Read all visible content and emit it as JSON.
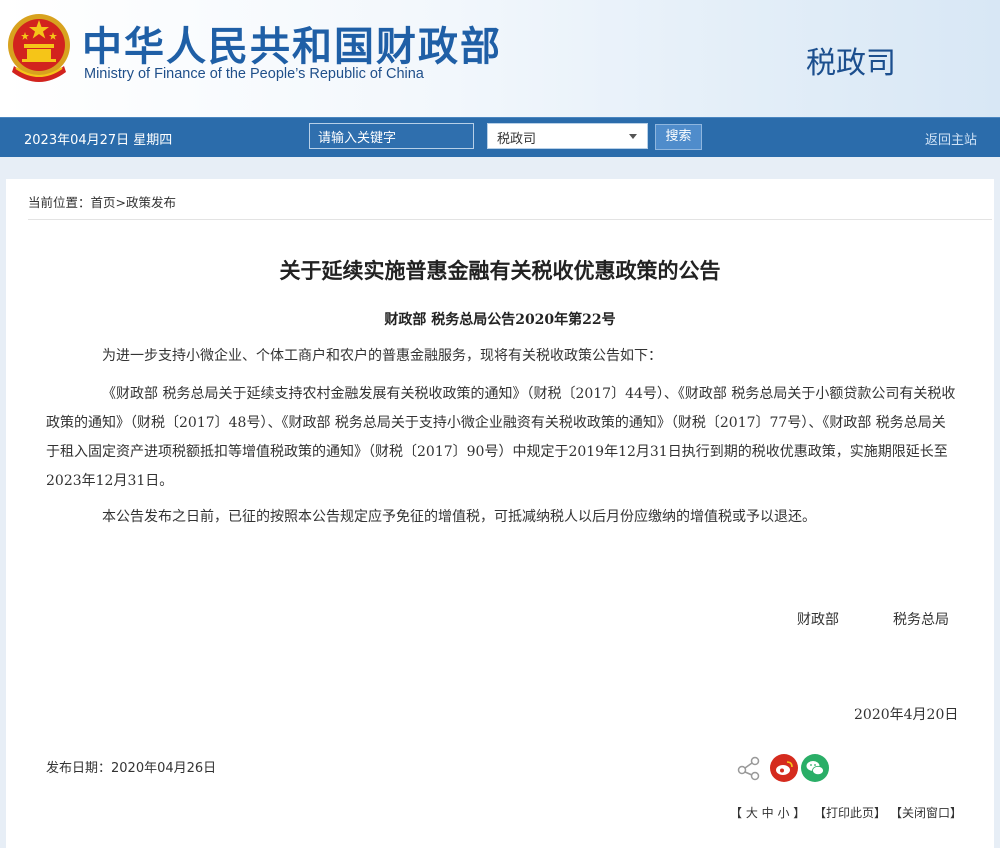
{
  "header": {
    "site_name_cn": "中华人民共和国财政部",
    "site_name_en": "Ministry of Finance of the People’s Republic of China",
    "department": "税政司"
  },
  "topbar": {
    "date": "2023年04月27日  星期四",
    "search_placeholder": "请输入关键字",
    "select_value": "税政司",
    "search_button": "搜索",
    "home_link": "返回主站"
  },
  "breadcrumb": "当前位置：首页>政策发布",
  "article": {
    "title": "关于延续实施普惠金融有关税收优惠政策的公告",
    "doc_number": "财政部  税务总局公告2020年第22号",
    "paragraphs": [
      "为进一步支持小微企业、个体工商户和农户的普惠金融服务，现将有关税收政策公告如下：",
      "《财政部  税务总局关于延续支持农村金融发展有关税收政策的通知》（财税〔2017〕44号）、《财政部  税务总局关于小额贷款公司有关税收政策的通知》（财税〔2017〕48号）、《财政部  税务总局关于支持小微企业融资有关税收政策的通知》（财税〔2017〕77号）、《财政部  税务总局关于租入固定资产进项税额抵扣等增值税政策的通知》（财税〔2017〕90号）中规定于2019年12月31日执行到期的税收优惠政策，实施期限延长至2023年12月31日。",
      "本公告发布之日前，已征的按照本公告规定应予免征的增值税，可抵减纳税人以后月份应缴纳的增值税或予以退还。"
    ],
    "signatory_1": "财政部",
    "signatory_2": "税务总局",
    "sign_date": "2020年4月20日",
    "publish_date": "发布日期：2020年04月26日"
  },
  "share_icons": [
    "share-icon",
    "weibo-icon",
    "wechat-icon"
  ],
  "tools": {
    "font_size": "【 大 中 小 】",
    "print": "【打印此页】",
    "close": "【关闭窗口】"
  },
  "colors": {
    "brand_blue": "#1f5fa6",
    "nav_bar": "#2b6cab",
    "weibo": "#d52b1e",
    "wechat": "#2aae67"
  }
}
